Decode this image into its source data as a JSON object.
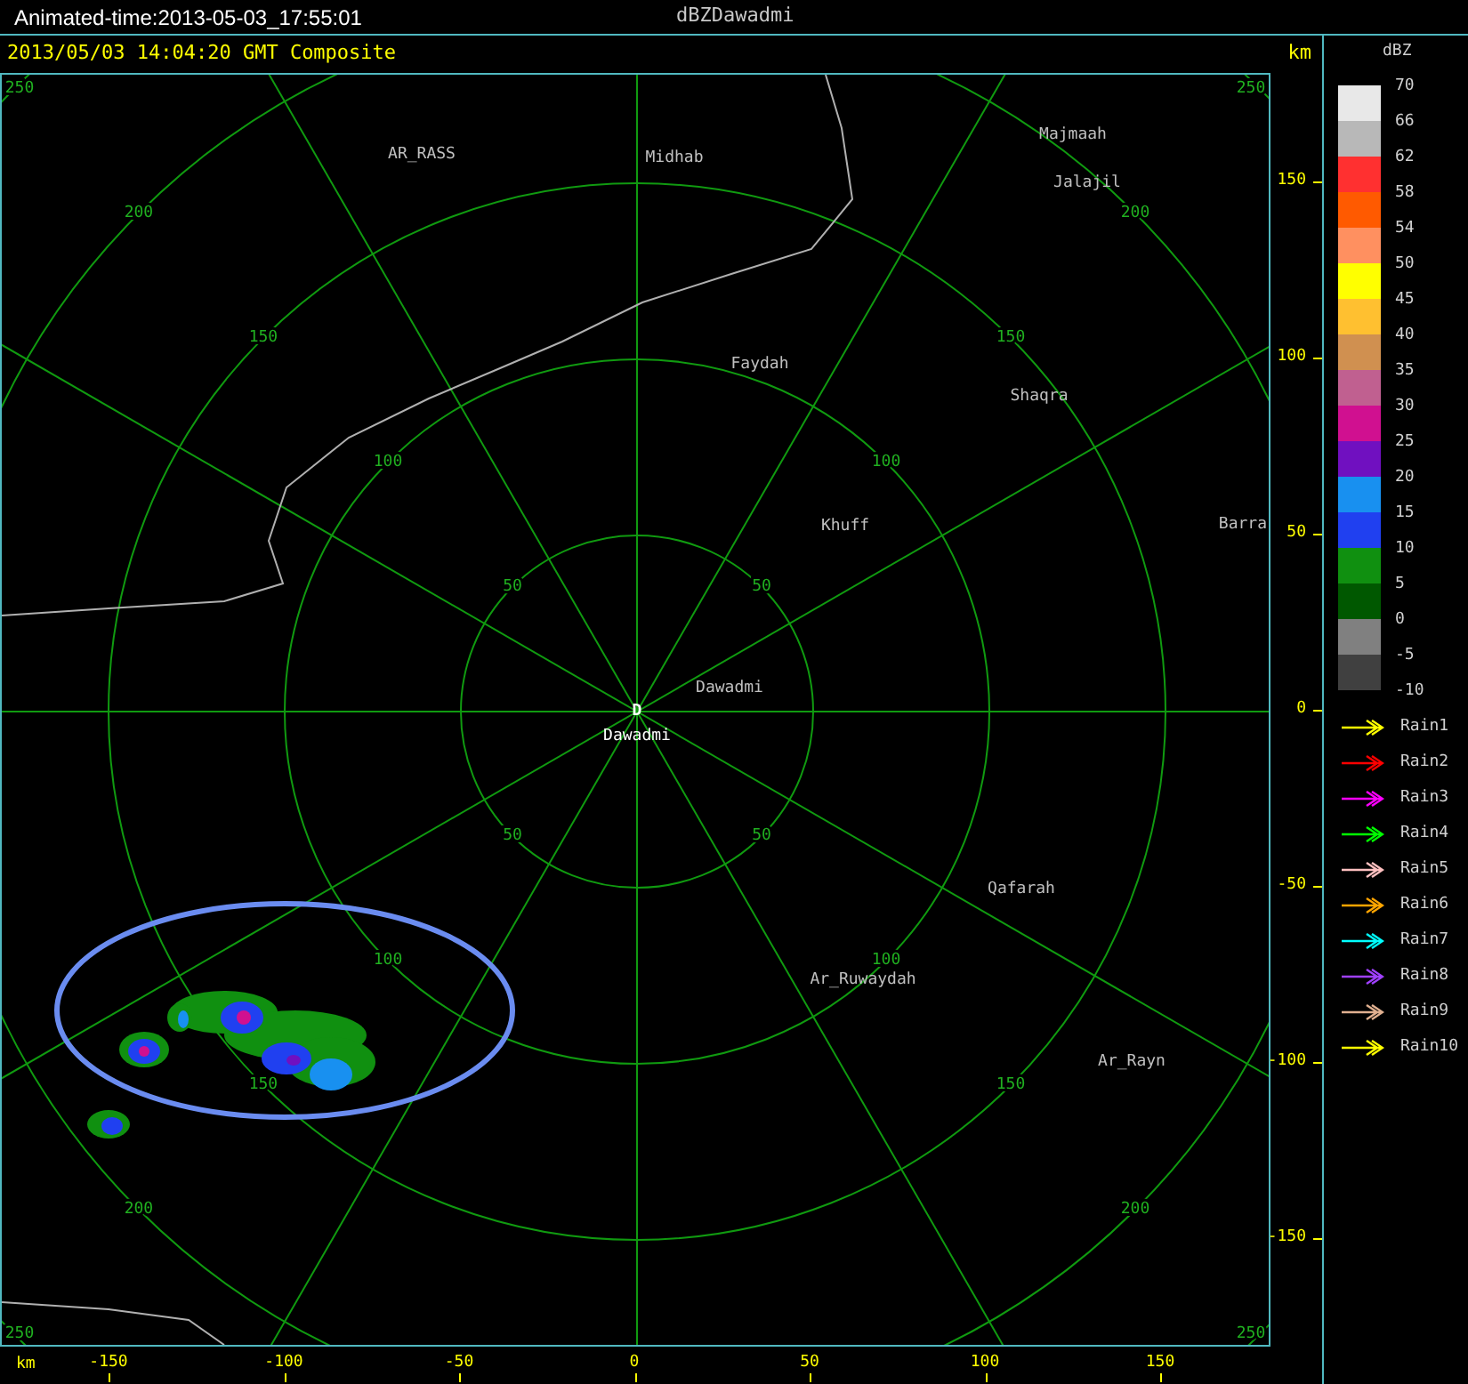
{
  "header": {
    "animated_time": "Animated-time:2013-05-03_17:55:01",
    "product": "dBZDawadmi"
  },
  "subheader": {
    "timestamp": "2013/05/03 14:04:20 GMT Composite",
    "unit": "km"
  },
  "plot": {
    "rings": [
      {
        "labels": [
          "50",
          "50",
          "50",
          "50"
        ]
      },
      {
        "labels": [
          "100",
          "100",
          "100",
          "100"
        ]
      },
      {
        "labels": [
          "150",
          "150",
          "150",
          "150"
        ]
      },
      {
        "labels": [
          "200",
          "200",
          "200",
          "200"
        ]
      },
      {
        "labels": [
          "250",
          "250",
          "250",
          "250"
        ]
      }
    ],
    "places": [
      {
        "name": "AR_RASS"
      },
      {
        "name": "Midhab"
      },
      {
        "name": "Majmaah"
      },
      {
        "name": "Jalajil"
      },
      {
        "name": "Faydah"
      },
      {
        "name": "Shaqra"
      },
      {
        "name": "Khuff"
      },
      {
        "name": "Barra"
      },
      {
        "name": "Dawadmi"
      },
      {
        "name": "Qafarah"
      },
      {
        "name": "Ar_Ruwaydah"
      },
      {
        "name": "Ar_Rayn"
      }
    ],
    "radar_marker": "D",
    "radar_name": "Dawadmi"
  },
  "y_axis": {
    "ticks": [
      "150",
      "100",
      "50",
      "0",
      "-50",
      "-100",
      "-150"
    ]
  },
  "x_axis": {
    "unit": "km",
    "ticks": [
      "-150",
      "-100",
      "-50",
      "0",
      "50",
      "100",
      "150"
    ]
  },
  "legend": {
    "title": "dBZ",
    "bins": [
      {
        "color": "#e8e8e8"
      },
      {
        "color": "#b8b8b8"
      },
      {
        "color": "#ff3030"
      },
      {
        "color": "#ff5a00"
      },
      {
        "color": "#ff9060"
      },
      {
        "color": "#ffff00"
      },
      {
        "color": "#ffc030"
      },
      {
        "color": "#d09050"
      },
      {
        "color": "#c06090"
      },
      {
        "color": "#d01090"
      },
      {
        "color": "#7010c0"
      },
      {
        "color": "#1890f0"
      },
      {
        "color": "#2040f0"
      },
      {
        "color": "#109010"
      },
      {
        "color": "#005800"
      },
      {
        "color": "#808080"
      },
      {
        "color": "#404040"
      }
    ],
    "labels": [
      "70",
      "66",
      "62",
      "58",
      "54",
      "50",
      "45",
      "40",
      "35",
      "30",
      "25",
      "20",
      "15",
      "10",
      "5",
      "0",
      "-5",
      "-10"
    ]
  },
  "rain_tracks": [
    {
      "label": "Rain1",
      "color": "#ffff00"
    },
    {
      "label": "Rain2",
      "color": "#ff0000"
    },
    {
      "label": "Rain3",
      "color": "#ff00ff"
    },
    {
      "label": "Rain4",
      "color": "#00ff00"
    },
    {
      "label": "Rain5",
      "color": "#ffc0c0"
    },
    {
      "label": "Rain6",
      "color": "#ffa500"
    },
    {
      "label": "Rain7",
      "color": "#00ffff"
    },
    {
      "label": "Rain8",
      "color": "#a040ff"
    },
    {
      "label": "Rain9",
      "color": "#e0b090"
    },
    {
      "label": "Rain10",
      "color": "#ffff00"
    }
  ]
}
